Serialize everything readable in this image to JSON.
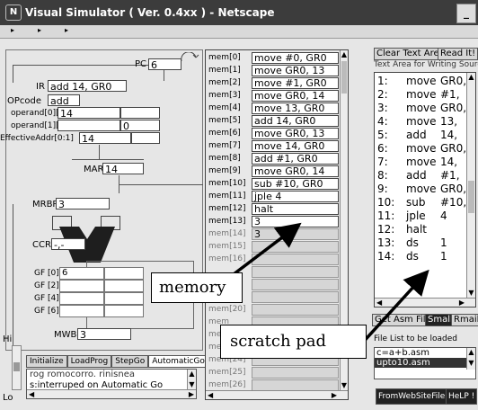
{
  "window": {
    "title": "Visual Simulator ( Ver. 0.4xx ) - Netscape",
    "app_icon": "netscape-icon",
    "control_label": "_"
  },
  "cpu": {
    "pc_label": "PC",
    "pc_value": "6",
    "ir_label": "IR",
    "ir_value": "add 14, GR0",
    "opcode_label": "OPcode",
    "opcode_value": "add",
    "operand0_label": "operand[0][2]",
    "operand0_value": "14",
    "operand1_label": "operand[1][3]",
    "operand1_value": "0",
    "eaddr_label": "EffectiveAddr[0:1]",
    "eaddr_value": "14",
    "mar_label": "MAR",
    "mar_value": "14",
    "mrbr_label": "MRBR",
    "mrbr_value": "3",
    "ccr_label": "CCR",
    "ccr_value": "-,-",
    "gf_rows": [
      {
        "label": "GF [0][1]",
        "value": "6"
      },
      {
        "label": "GF [2][3]",
        "value": ""
      },
      {
        "label": "GF [4][5]",
        "value": ""
      },
      {
        "label": "GF [6][7]",
        "value": ""
      }
    ],
    "mwbr_label": "MWBR",
    "mwbr_value": "3",
    "hi_label": "Hi",
    "lo_label": "Lo"
  },
  "controls": {
    "buttons": [
      "Initialize",
      "LoadProg",
      "StepGo",
      "AutomaticGo"
    ],
    "log_lines": [
      "rog romocorro. rinisnea",
      "s:interruped on Automatic Go"
    ]
  },
  "memory": {
    "rows": [
      {
        "label": "mem[0]",
        "value": "move #0, GR0"
      },
      {
        "label": "mem[1]",
        "value": "move GR0, 13"
      },
      {
        "label": "mem[2]",
        "value": "move #1, GR0"
      },
      {
        "label": "mem[3]",
        "value": "move GR0, 14"
      },
      {
        "label": "mem[4]",
        "value": "move 13, GR0"
      },
      {
        "label": "mem[5]",
        "value": "add 14, GR0"
      },
      {
        "label": "mem[6]",
        "value": "move GR0, 13"
      },
      {
        "label": "mem[7]",
        "value": "move 14, GR0"
      },
      {
        "label": "mem[8]",
        "value": "add #1, GR0"
      },
      {
        "label": "mem[9]",
        "value": "move GR0, 14"
      },
      {
        "label": "mem[10]",
        "value": "sub #10, GR0"
      },
      {
        "label": "mem[11]",
        "value": "jple 4"
      },
      {
        "label": "mem[12]",
        "value": "halt"
      },
      {
        "label": "mem[13]",
        "value": "3"
      },
      {
        "label": "mem[14]",
        "value": "3"
      },
      {
        "label": "mem[15]",
        "value": ""
      },
      {
        "label": "mem[16]",
        "value": ""
      },
      {
        "label": "",
        "value": ""
      },
      {
        "label": "",
        "value": ""
      },
      {
        "label": "",
        "value": ""
      },
      {
        "label": "mem[20]",
        "value": ""
      },
      {
        "label": "mem",
        "value": ""
      },
      {
        "label": "mem",
        "value": ""
      },
      {
        "label": "mem",
        "value": ""
      },
      {
        "label": "mem[24]",
        "value": ""
      },
      {
        "label": "mem[25]",
        "value": ""
      },
      {
        "label": "mem[26]",
        "value": ""
      }
    ]
  },
  "editor": {
    "clear_button": "Clear Text Area",
    "read_button": "Read It!",
    "caption": "Text Area for Writing Source",
    "lines": [
      {
        "num": "1:",
        "op": "move",
        "arg": "GR0,"
      },
      {
        "num": "2:",
        "op": "move",
        "arg": "#1,"
      },
      {
        "num": "3:",
        "op": "move",
        "arg": "GR0,"
      },
      {
        "num": "4:",
        "op": "move",
        "arg": "13,"
      },
      {
        "num": "5:",
        "op": "add",
        "arg": "14,"
      },
      {
        "num": "6:",
        "op": "move",
        "arg": "GR0,"
      },
      {
        "num": "7:",
        "op": "move",
        "arg": "14,"
      },
      {
        "num": "8:",
        "op": "add",
        "arg": "#1,"
      },
      {
        "num": "9:",
        "op": "move",
        "arg": "GR0,"
      },
      {
        "num": "10:",
        "op": "sub",
        "arg": "#10,"
      },
      {
        "num": "11:",
        "op": "jple",
        "arg": "4"
      },
      {
        "num": "12:",
        "op": "halt",
        "arg": ""
      },
      {
        "num": "13:",
        "op": "ds",
        "arg": "1"
      },
      {
        "num": "14:",
        "op": "ds",
        "arg": "1"
      }
    ],
    "get_asm_label": "Get Asm File",
    "small_label": "Small",
    "rmail_label": "Rmail",
    "file_list_caption": "File List to be loaded",
    "files": [
      "c=a+b.asm",
      "upto10.asm"
    ],
    "selected_file": "upto10.asm",
    "from_web_button": "FromWebSiteFile",
    "help_button": "HeLP !"
  },
  "annotations": {
    "memory": "memory",
    "scratch_pad": "scratch pad"
  },
  "colors": {
    "title_bar": "#3c3c3c",
    "panel": "#e6e6e6",
    "field": "#ffffff",
    "alu": "#1e1e1e",
    "dark_button": "#222222"
  }
}
